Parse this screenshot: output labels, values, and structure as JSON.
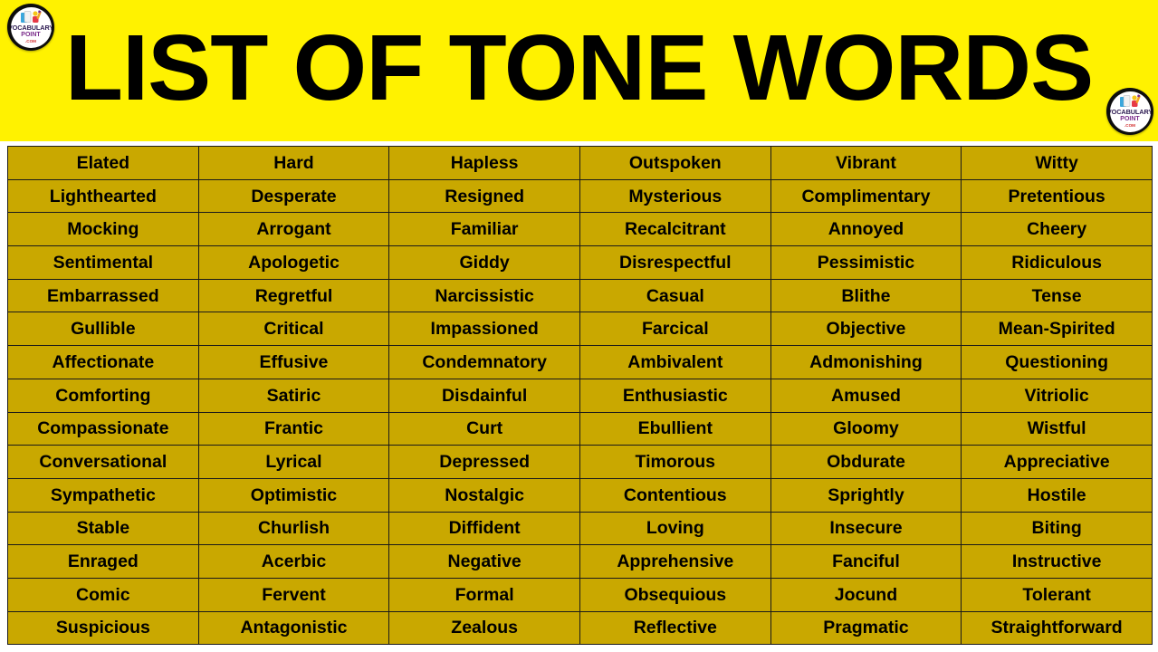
{
  "header": {
    "title": "LIST OF TONE WORDS",
    "background_color": "#FFF200",
    "text_color": "#000000",
    "logo": {
      "line1": "VOCABULARY",
      "line2": "POINT",
      "line3": ".COM"
    }
  },
  "table": {
    "cell_background_color": "#C9A800",
    "cell_text_color": "#000000",
    "border_color": "#1A1A1A",
    "columns": 6,
    "rows_count": 15,
    "rows": [
      [
        "Elated",
        "Hard",
        "Hapless",
        "Outspoken",
        "Vibrant",
        "Witty"
      ],
      [
        "Lighthearted",
        "Desperate",
        "Resigned",
        "Mysterious",
        "Complimentary",
        "Pretentious"
      ],
      [
        "Mocking",
        "Arrogant",
        "Familiar",
        "Recalcitrant",
        "Annoyed",
        "Cheery"
      ],
      [
        "Sentimental",
        "Apologetic",
        "Giddy",
        "Disrespectful",
        "Pessimistic",
        "Ridiculous"
      ],
      [
        "Embarrassed",
        "Regretful",
        "Narcissistic",
        "Casual",
        "Blithe",
        "Tense"
      ],
      [
        "Gullible",
        "Critical",
        "Impassioned",
        "Farcical",
        "Objective",
        "Mean-Spirited"
      ],
      [
        "Affectionate",
        "Effusive",
        "Condemnatory",
        "Ambivalent",
        "Admonishing",
        "Questioning"
      ],
      [
        "Comforting",
        "Satiric",
        "Disdainful",
        "Enthusiastic",
        "Amused",
        "Vitriolic"
      ],
      [
        "Compassionate",
        "Frantic",
        "Curt",
        "Ebullient",
        "Gloomy",
        "Wistful"
      ],
      [
        "Conversational",
        "Lyrical",
        "Depressed",
        "Timorous",
        "Obdurate",
        "Appreciative"
      ],
      [
        "Sympathetic",
        "Optimistic",
        "Nostalgic",
        "Contentious",
        "Sprightly",
        "Hostile"
      ],
      [
        "Stable",
        "Churlish",
        "Diffident",
        "Loving",
        "Insecure",
        "Biting"
      ],
      [
        "Enraged",
        "Acerbic",
        "Negative",
        "Apprehensive",
        "Fanciful",
        "Instructive"
      ],
      [
        "Comic",
        "Fervent",
        "Formal",
        "Obsequious",
        "Jocund",
        "Tolerant"
      ],
      [
        "Suspicious",
        "Antagonistic",
        "Zealous",
        "Reflective",
        "Pragmatic",
        "Straightforward"
      ]
    ]
  }
}
